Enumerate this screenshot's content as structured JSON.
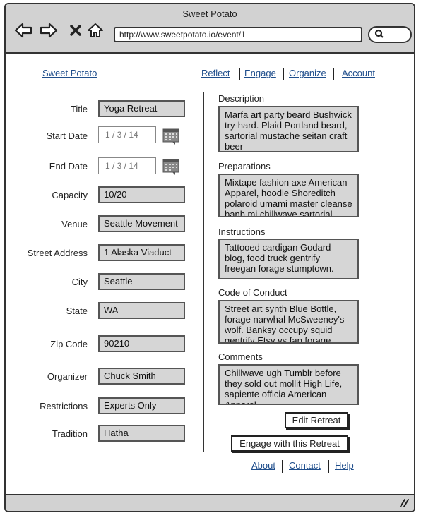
{
  "window": {
    "title": "Sweet Potato",
    "url": "http://www.sweetpotato.io/event/1"
  },
  "icons": {
    "back": "left-arrow-icon",
    "forward": "right-arrow-icon",
    "close": "x-icon",
    "home": "home-icon",
    "search": "search-icon",
    "calendar": "calendar-icon",
    "resize": "resize-grip-icon"
  },
  "header": {
    "brand": "Sweet Potato",
    "nav": [
      "Reflect",
      "Engage",
      "Organize",
      "Account"
    ]
  },
  "form": {
    "title_label": "Title",
    "title_value": "Yoga Retreat",
    "start_label": "Start Date",
    "start_value": "1 / 3 / 14",
    "end_label": "End Date",
    "end_value": "1 / 3 / 14",
    "capacity_label": "Capacity",
    "capacity_value": "10/20",
    "venue_label": "Venue",
    "venue_value": "Seattle Movement",
    "street_label": "Street Address",
    "street_value": "1 Alaska Viaduct",
    "city_label": "City",
    "city_value": "Seattle",
    "state_label": "State",
    "state_value": "WA",
    "zip_label": "Zip Code",
    "zip_value": "90210",
    "organizer_label": "Organizer",
    "organizer_value": "Chuck Smith",
    "restrictions_label": "Restrictions",
    "restrictions_value": "Experts Only",
    "tradition_label": "Tradition",
    "tradition_value": "Hatha"
  },
  "details": {
    "description_label": "Description",
    "description_text": "Marfa art party beard Bushwick try-hard. Plaid Portland beard, sartorial mustache seitan craft beer",
    "preparations_label": "Preparations",
    "preparations_text": "Mixtape fashion axe American Apparel, hoodie Shoreditch polaroid umami master cleanse banh mi chillwave sartorial",
    "instructions_label": "Instructions",
    "instructions_text": "Tattooed cardigan Godard blog, food truck gentrify freegan forage stumptown.",
    "conduct_label": "Code of Conduct",
    "conduct_text": "Street art synth Blue Bottle, forage narwhal McSweeney's wolf. Banksy occupy squid gentrify Etsy vs fap forage",
    "comments_label": "Comments",
    "comments_text": "Chillwave ugh Tumblr before they sold out mollit High Life, sapiente officia American Apparel"
  },
  "actions": {
    "edit": "Edit Retreat",
    "engage": "Engage with this  Retreat"
  },
  "footer": {
    "links": [
      "About",
      "Contact",
      "Help"
    ]
  },
  "colors": {
    "chrome": "#d2d2d2",
    "field": "#d6d6d6",
    "link": "#1f4e8c"
  }
}
